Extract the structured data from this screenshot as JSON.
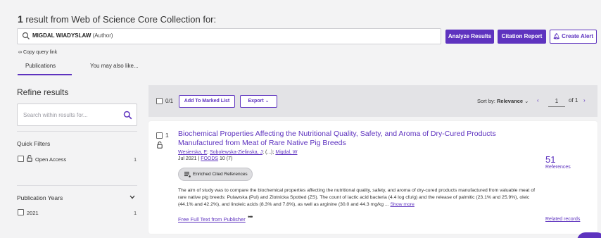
{
  "header": {
    "count": "1",
    "title_rest": "result from Web of Science Core Collection for:"
  },
  "query": {
    "term": "MIGDAL WIADYSLAW",
    "field": "(Author)"
  },
  "actions": {
    "analyze": "Analyze Results",
    "citation": "Citation Report",
    "alert": "Create Alert"
  },
  "copy_query": "Copy query link",
  "tabs": {
    "publications": "Publications",
    "also_like": "You may also like..."
  },
  "sidebar": {
    "title": "Refine results",
    "search_placeholder": "Search within results for...",
    "quick_filters": {
      "heading": "Quick Filters",
      "items": [
        {
          "label": "Open Access",
          "count": "1"
        }
      ]
    },
    "pub_years": {
      "heading": "Publication Years",
      "items": [
        {
          "label": "2021",
          "count": "1"
        }
      ]
    }
  },
  "toolbar": {
    "selected": "0/1",
    "add_marked": "Add To Marked List",
    "export": "Export",
    "sort_by": "Sort by:",
    "sort_value": "Relevance",
    "page": "1",
    "of_pages": "of 1"
  },
  "record": {
    "index": "1",
    "title": "Biochemical Properties Affecting the Nutritional Quality, Safety, and Aroma of Dry-Cured Products Manufactured from Meat of Rare Native Pig Breeds",
    "authors": [
      "Wesierska, E",
      "Sobolewska-Zielinska, J",
      "(...)",
      "Migdal, W"
    ],
    "date": "Jul 2021",
    "journal": "FOODS",
    "volume_issue": "10 (7)",
    "enriched": "Enriched Cited References",
    "abstract": "The aim of study was to compare the biochemical properties affecting the nutritional quality, safety, and aroma of dry-cured products manufactured from valuable meat of rare native pig breeds: Pulawska (Pul) and Zlotnicka Spotted (ZS). The count of lactic acid bacteria (4.4 log cfu/g) and the release of palmitic (23.1% and 25.9%), oleic (44.1% and 42.2%), and linoleic acids (8.3% and 7.8%), as well as arginine (30.0 and 44.3 mg/kg ...",
    "show_more": "Show more",
    "full_text": "Free Full Text from Publisher",
    "references_count": "51",
    "references_label": "References",
    "related": "Related records"
  },
  "colors": {
    "accent": "#5e33bf",
    "background": "#f3f3f4"
  }
}
